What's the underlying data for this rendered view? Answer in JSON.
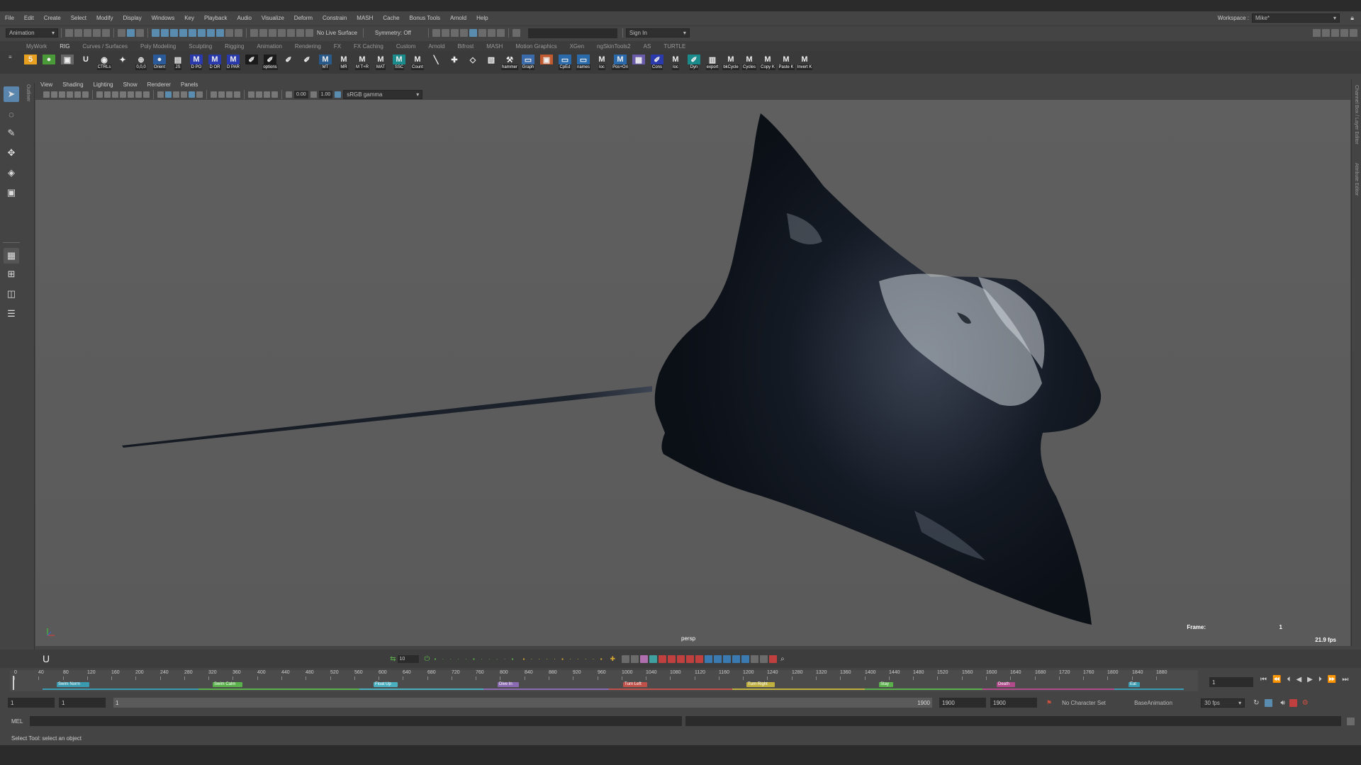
{
  "menubar": {
    "items": [
      "File",
      "Edit",
      "Create",
      "Select",
      "Modify",
      "Display",
      "Windows",
      "Key",
      "Playback",
      "Audio",
      "Visualize",
      "Deform",
      "Constrain",
      "MASH",
      "Cache",
      "Bonus Tools",
      "Arnold",
      "Help"
    ],
    "workspace_label": "Workspace :",
    "workspace_value": "Mike*"
  },
  "status": {
    "menuset": "Animation",
    "live_surface": "No Live Surface",
    "symmetry": "Symmetry: Off",
    "sign_in": "Sign In"
  },
  "shelf_tabs": [
    "MyWork",
    "RIG",
    "Curves / Surfaces",
    "Poly Modeling",
    "Sculpting",
    "Rigging",
    "Animation",
    "Rendering",
    "FX",
    "FX Caching",
    "Custom",
    "Arnold",
    "Bifrost",
    "MASH",
    "Motion Graphics",
    "XGen",
    "ngSkinTools2",
    "AS",
    "TURTLE"
  ],
  "shelf_active_tab": "RIG",
  "shelf_items": [
    {
      "label": "",
      "glyph": "5",
      "color": "#e8a020"
    },
    {
      "label": "",
      "glyph": "●",
      "color": "#4a9a3a"
    },
    {
      "label": "",
      "glyph": "▣",
      "color": "#666666"
    },
    {
      "label": "",
      "glyph": "U",
      "color": "#3a3a3a"
    },
    {
      "label": "CTRLs",
      "glyph": "◉",
      "color": "#3a3a3a"
    },
    {
      "label": "",
      "glyph": "✦",
      "color": "#3a3a3a"
    },
    {
      "label": "0,0,0",
      "glyph": "⊕",
      "color": "#3a3a3a"
    },
    {
      "label": "Orient",
      "glyph": "●",
      "color": "#2a5a9a"
    },
    {
      "label": "JS",
      "glyph": "▤",
      "color": "#3a3a3a"
    },
    {
      "label": "D PO",
      "glyph": "M",
      "color": "#2a3aaa"
    },
    {
      "label": "D OR",
      "glyph": "M",
      "color": "#2a3aaa"
    },
    {
      "label": "D PAR",
      "glyph": "M",
      "color": "#2a3aaa"
    },
    {
      "label": "",
      "glyph": "✐",
      "color": "#1a1a1a"
    },
    {
      "label": "options",
      "glyph": "✐",
      "color": "#1a1a1a"
    },
    {
      "label": "",
      "glyph": "✐",
      "color": "#3a3a3a"
    },
    {
      "label": "",
      "glyph": "✐",
      "color": "#3a3a3a"
    },
    {
      "label": "MT",
      "glyph": "M",
      "color": "#2a5a8a"
    },
    {
      "label": "MR",
      "glyph": "M",
      "color": "#3a3a3a"
    },
    {
      "label": "M T+R",
      "glyph": "M",
      "color": "#3a3a3a"
    },
    {
      "label": "MAT",
      "glyph": "M",
      "color": "#3a3a3a"
    },
    {
      "label": "SSC",
      "glyph": "M",
      "color": "#1a8a8a"
    },
    {
      "label": "Count",
      "glyph": "M",
      "color": "#3a3a3a"
    },
    {
      "label": "",
      "glyph": "╲",
      "color": "#3a3a3a"
    },
    {
      "label": "",
      "glyph": "✚",
      "color": "#3a3a3a"
    },
    {
      "label": "",
      "glyph": "◇",
      "color": "#3a3a3a"
    },
    {
      "label": "",
      "glyph": "▧",
      "color": "#3a3a3a"
    },
    {
      "label": "hammer",
      "glyph": "⚒",
      "color": "#3a3a3a"
    },
    {
      "label": "Graph",
      "glyph": "▭",
      "color": "#3a6aaa"
    },
    {
      "label": "",
      "glyph": "▣",
      "color": "#c05a30"
    },
    {
      "label": "CpEd",
      "glyph": "▭",
      "color": "#2a6aaa"
    },
    {
      "label": "names",
      "glyph": "▭",
      "color": "#2a6aaa"
    },
    {
      "label": "loc",
      "glyph": "M",
      "color": "#3a3a3a"
    },
    {
      "label": "Pos+Ori",
      "glyph": "M",
      "color": "#2a6aaa"
    },
    {
      "label": "",
      "glyph": "▦",
      "color": "#6a5aaa"
    },
    {
      "label": "Cons",
      "glyph": "✐",
      "color": "#2a3aaa"
    },
    {
      "label": "loc",
      "glyph": "M",
      "color": "#3a3a3a"
    },
    {
      "label": "Dyn",
      "glyph": "✐",
      "color": "#1a8a8a"
    },
    {
      "label": "export",
      "glyph": "▥",
      "color": "#3a3a3a"
    },
    {
      "label": "bkCycle",
      "glyph": "M",
      "color": "#3a3a3a"
    },
    {
      "label": "Cycles",
      "glyph": "M",
      "color": "#3a3a3a"
    },
    {
      "label": "Copy K",
      "glyph": "M",
      "color": "#3a3a3a"
    },
    {
      "label": "Paste K",
      "glyph": "M",
      "color": "#3a3a3a"
    },
    {
      "label": "Invert K",
      "glyph": "M",
      "color": "#3a3a3a"
    }
  ],
  "panel_menu": [
    "View",
    "Shading",
    "Lighting",
    "Show",
    "Renderer",
    "Panels"
  ],
  "panel_toolbar": {
    "value1": "0.00",
    "value2": "1.00",
    "color_space": "sRGB gamma"
  },
  "side_labels": {
    "outliner": "Outliner",
    "channel_box": "Channel Box / Layer Editor",
    "attribute_editor": "Attribute Editor"
  },
  "viewport": {
    "camera": "persp",
    "frame_label": "Frame:",
    "frame_value": "1",
    "fps": "21.9 fps"
  },
  "anim_toolbar": {
    "step_value": "10"
  },
  "timeline": {
    "ticks": [
      "0",
      "40",
      "80",
      "120",
      "160",
      "200",
      "240",
      "280",
      "320",
      "360",
      "400",
      "440",
      "480",
      "520",
      "560",
      "600",
      "640",
      "680",
      "720",
      "760",
      "800",
      "840",
      "880",
      "920",
      "960",
      "1000",
      "1040",
      "1080",
      "1120",
      "1160",
      "1200",
      "1240",
      "1280",
      "1320",
      "1360",
      "1400",
      "1440",
      "1480",
      "1520",
      "1560",
      "1600",
      "1640",
      "1680",
      "1720",
      "1760",
      "1800",
      "1840",
      "1880"
    ],
    "current_frame": "1",
    "clips": [
      {
        "name": "Swim Norm",
        "color": "#3a9ab0"
      },
      {
        "name": "Swim Calm",
        "color": "#5ab04a"
      },
      {
        "name": "Float Up",
        "color": "#4ab0c0"
      },
      {
        "name": "Dive In",
        "color": "#8a6ab0"
      },
      {
        "name": "Turn Left",
        "color": "#c0504a"
      },
      {
        "name": "Turn Right",
        "color": "#c0b040"
      },
      {
        "name": "Stay",
        "color": "#5ab04a"
      },
      {
        "name": "Death",
        "color": "#b04a8a"
      },
      {
        "name": "Eat",
        "color": "#3a9ab0"
      }
    ]
  },
  "range": {
    "start": "1",
    "inner_start": "1",
    "slider_start": "1",
    "slider_end": "1900",
    "inner_end": "1900",
    "end": "1900",
    "character_set": "No Character Set",
    "anim_layer": "BaseAnimation",
    "fps": "30 fps"
  },
  "command": {
    "lang": "MEL"
  },
  "help_line": "Select Tool: select an object"
}
